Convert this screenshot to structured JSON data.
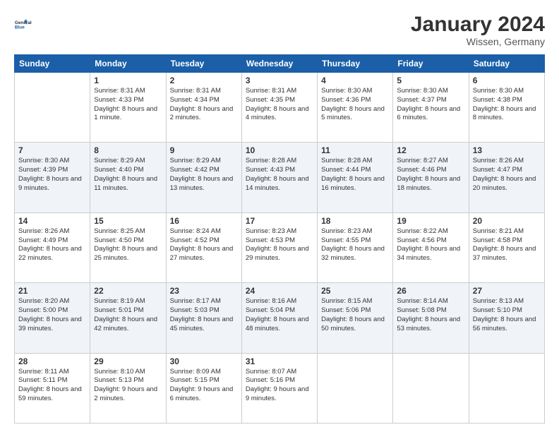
{
  "logo": {
    "line1": "General",
    "line2": "Blue"
  },
  "header": {
    "month_year": "January 2024",
    "location": "Wissen, Germany"
  },
  "weekdays": [
    "Sunday",
    "Monday",
    "Tuesday",
    "Wednesday",
    "Thursday",
    "Friday",
    "Saturday"
  ],
  "weeks": [
    [
      {
        "day": "",
        "sunrise": "",
        "sunset": "",
        "daylight": ""
      },
      {
        "day": "1",
        "sunrise": "Sunrise: 8:31 AM",
        "sunset": "Sunset: 4:33 PM",
        "daylight": "Daylight: 8 hours and 1 minute."
      },
      {
        "day": "2",
        "sunrise": "Sunrise: 8:31 AM",
        "sunset": "Sunset: 4:34 PM",
        "daylight": "Daylight: 8 hours and 2 minutes."
      },
      {
        "day": "3",
        "sunrise": "Sunrise: 8:31 AM",
        "sunset": "Sunset: 4:35 PM",
        "daylight": "Daylight: 8 hours and 4 minutes."
      },
      {
        "day": "4",
        "sunrise": "Sunrise: 8:30 AM",
        "sunset": "Sunset: 4:36 PM",
        "daylight": "Daylight: 8 hours and 5 minutes."
      },
      {
        "day": "5",
        "sunrise": "Sunrise: 8:30 AM",
        "sunset": "Sunset: 4:37 PM",
        "daylight": "Daylight: 8 hours and 6 minutes."
      },
      {
        "day": "6",
        "sunrise": "Sunrise: 8:30 AM",
        "sunset": "Sunset: 4:38 PM",
        "daylight": "Daylight: 8 hours and 8 minutes."
      }
    ],
    [
      {
        "day": "7",
        "sunrise": "Sunrise: 8:30 AM",
        "sunset": "Sunset: 4:39 PM",
        "daylight": "Daylight: 8 hours and 9 minutes."
      },
      {
        "day": "8",
        "sunrise": "Sunrise: 8:29 AM",
        "sunset": "Sunset: 4:40 PM",
        "daylight": "Daylight: 8 hours and 11 minutes."
      },
      {
        "day": "9",
        "sunrise": "Sunrise: 8:29 AM",
        "sunset": "Sunset: 4:42 PM",
        "daylight": "Daylight: 8 hours and 13 minutes."
      },
      {
        "day": "10",
        "sunrise": "Sunrise: 8:28 AM",
        "sunset": "Sunset: 4:43 PM",
        "daylight": "Daylight: 8 hours and 14 minutes."
      },
      {
        "day": "11",
        "sunrise": "Sunrise: 8:28 AM",
        "sunset": "Sunset: 4:44 PM",
        "daylight": "Daylight: 8 hours and 16 minutes."
      },
      {
        "day": "12",
        "sunrise": "Sunrise: 8:27 AM",
        "sunset": "Sunset: 4:46 PM",
        "daylight": "Daylight: 8 hours and 18 minutes."
      },
      {
        "day": "13",
        "sunrise": "Sunrise: 8:26 AM",
        "sunset": "Sunset: 4:47 PM",
        "daylight": "Daylight: 8 hours and 20 minutes."
      }
    ],
    [
      {
        "day": "14",
        "sunrise": "Sunrise: 8:26 AM",
        "sunset": "Sunset: 4:49 PM",
        "daylight": "Daylight: 8 hours and 22 minutes."
      },
      {
        "day": "15",
        "sunrise": "Sunrise: 8:25 AM",
        "sunset": "Sunset: 4:50 PM",
        "daylight": "Daylight: 8 hours and 25 minutes."
      },
      {
        "day": "16",
        "sunrise": "Sunrise: 8:24 AM",
        "sunset": "Sunset: 4:52 PM",
        "daylight": "Daylight: 8 hours and 27 minutes."
      },
      {
        "day": "17",
        "sunrise": "Sunrise: 8:23 AM",
        "sunset": "Sunset: 4:53 PM",
        "daylight": "Daylight: 8 hours and 29 minutes."
      },
      {
        "day": "18",
        "sunrise": "Sunrise: 8:23 AM",
        "sunset": "Sunset: 4:55 PM",
        "daylight": "Daylight: 8 hours and 32 minutes."
      },
      {
        "day": "19",
        "sunrise": "Sunrise: 8:22 AM",
        "sunset": "Sunset: 4:56 PM",
        "daylight": "Daylight: 8 hours and 34 minutes."
      },
      {
        "day": "20",
        "sunrise": "Sunrise: 8:21 AM",
        "sunset": "Sunset: 4:58 PM",
        "daylight": "Daylight: 8 hours and 37 minutes."
      }
    ],
    [
      {
        "day": "21",
        "sunrise": "Sunrise: 8:20 AM",
        "sunset": "Sunset: 5:00 PM",
        "daylight": "Daylight: 8 hours and 39 minutes."
      },
      {
        "day": "22",
        "sunrise": "Sunrise: 8:19 AM",
        "sunset": "Sunset: 5:01 PM",
        "daylight": "Daylight: 8 hours and 42 minutes."
      },
      {
        "day": "23",
        "sunrise": "Sunrise: 8:17 AM",
        "sunset": "Sunset: 5:03 PM",
        "daylight": "Daylight: 8 hours and 45 minutes."
      },
      {
        "day": "24",
        "sunrise": "Sunrise: 8:16 AM",
        "sunset": "Sunset: 5:04 PM",
        "daylight": "Daylight: 8 hours and 48 minutes."
      },
      {
        "day": "25",
        "sunrise": "Sunrise: 8:15 AM",
        "sunset": "Sunset: 5:06 PM",
        "daylight": "Daylight: 8 hours and 50 minutes."
      },
      {
        "day": "26",
        "sunrise": "Sunrise: 8:14 AM",
        "sunset": "Sunset: 5:08 PM",
        "daylight": "Daylight: 8 hours and 53 minutes."
      },
      {
        "day": "27",
        "sunrise": "Sunrise: 8:13 AM",
        "sunset": "Sunset: 5:10 PM",
        "daylight": "Daylight: 8 hours and 56 minutes."
      }
    ],
    [
      {
        "day": "28",
        "sunrise": "Sunrise: 8:11 AM",
        "sunset": "Sunset: 5:11 PM",
        "daylight": "Daylight: 8 hours and 59 minutes."
      },
      {
        "day": "29",
        "sunrise": "Sunrise: 8:10 AM",
        "sunset": "Sunset: 5:13 PM",
        "daylight": "Daylight: 9 hours and 2 minutes."
      },
      {
        "day": "30",
        "sunrise": "Sunrise: 8:09 AM",
        "sunset": "Sunset: 5:15 PM",
        "daylight": "Daylight: 9 hours and 6 minutes."
      },
      {
        "day": "31",
        "sunrise": "Sunrise: 8:07 AM",
        "sunset": "Sunset: 5:16 PM",
        "daylight": "Daylight: 9 hours and 9 minutes."
      },
      {
        "day": "",
        "sunrise": "",
        "sunset": "",
        "daylight": ""
      },
      {
        "day": "",
        "sunrise": "",
        "sunset": "",
        "daylight": ""
      },
      {
        "day": "",
        "sunrise": "",
        "sunset": "",
        "daylight": ""
      }
    ]
  ]
}
